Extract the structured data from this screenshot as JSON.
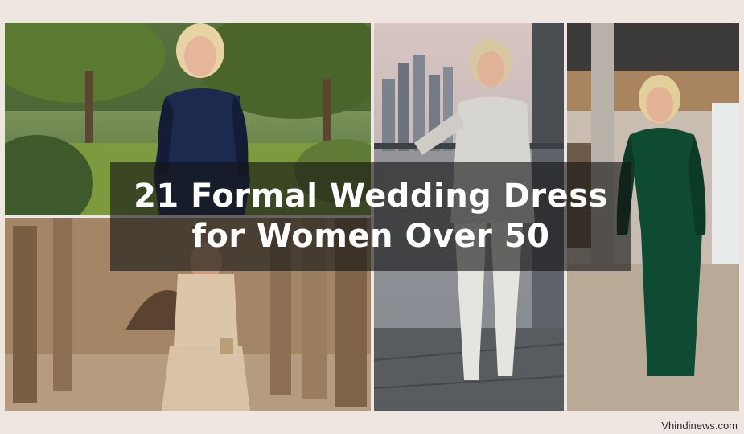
{
  "title": {
    "line1": "21 Formal Wedding Dress",
    "line2": "for Women Over 50"
  },
  "watermark": "Vhindinews.com",
  "colors": {
    "background": "#efe5e1",
    "banner": "rgba(20,20,20,0.62)",
    "navy_dress": "#1d2a4f",
    "velvet_green": "#0f4a32",
    "champagne_dress": "#d9c3a6",
    "silver_suit": "#d7d5d0"
  },
  "photos": [
    {
      "subject": "woman in navy lace dress in garden"
    },
    {
      "subject": "woman in champagne dress and jacket in stone arcade"
    },
    {
      "subject": "woman in silver pantsuit on city balcony"
    },
    {
      "subject": "woman in green velvet wrap gown in restaurant"
    }
  ]
}
